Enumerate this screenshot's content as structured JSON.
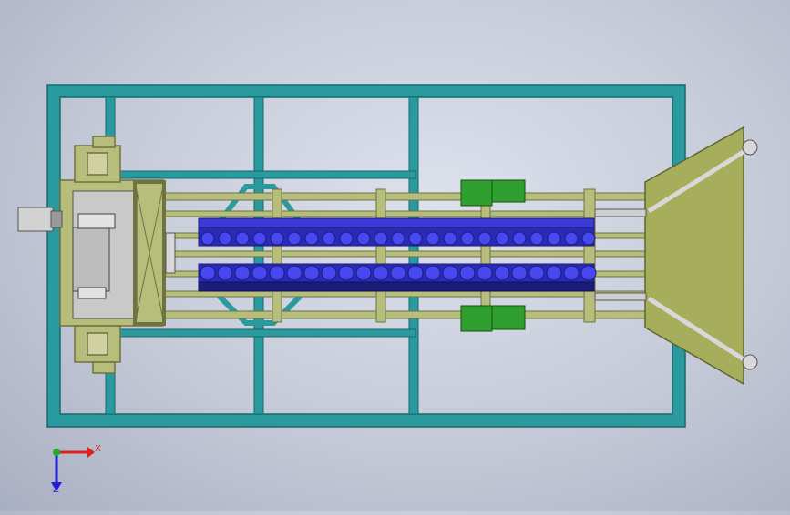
{
  "viewport": {
    "background": "#c8ccd9"
  },
  "colors": {
    "frame_outer": "#2a9a9e",
    "frame_inner": "#1f7f83",
    "rail": "#b7bd7a",
    "rail_edge": "#6e7340",
    "conveyor": "#3a3ad6",
    "conveyor_dark": "#1c1c7a",
    "roller": "#4444ee",
    "motor_gray": "#b9b9b9",
    "hopper": "#a6ae5c",
    "bracket_green": "#2fa02f"
  },
  "triad": {
    "x_label": "X",
    "z_label": "Z",
    "x_color": "#e02020",
    "y_color": "#20b020",
    "z_color": "#2020d0"
  }
}
